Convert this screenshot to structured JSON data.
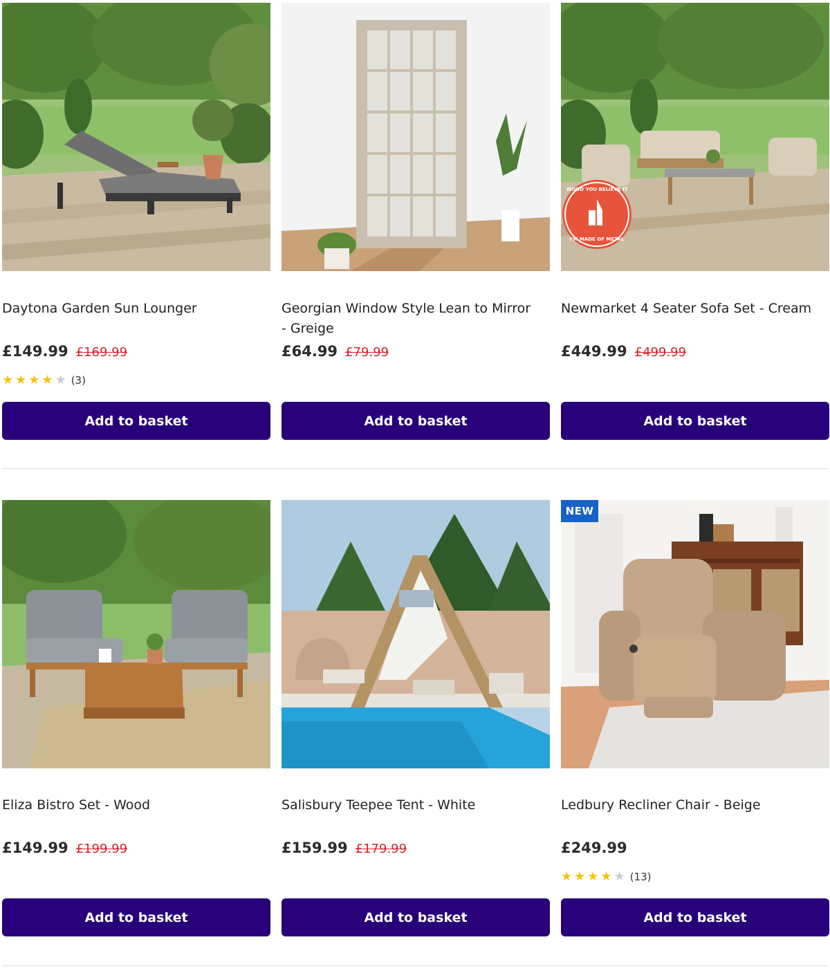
{
  "colors": {
    "button_bg": "#27007a",
    "button_text": "#ffffff",
    "was_price": "#d2232a",
    "star_on": "#f4c20d",
    "star_off": "#c9ced6",
    "new_badge": "#1862c6",
    "divider": "#cfe0e0"
  },
  "products": [
    {
      "title": "Daytona Garden Sun Lounger",
      "price": "£149.99",
      "was_price": "£169.99",
      "rating": 4,
      "rating_count": "(3)",
      "button_label": "Add to basket",
      "image": "garden-sun-lounger-photo"
    },
    {
      "title": "Georgian Window Style Lean to Mirror - Greige",
      "price": "£64.99",
      "was_price": "£79.99",
      "button_label": "Add to basket",
      "image": "window-mirror-photo"
    },
    {
      "title": "Newmarket 4 Seater Sofa Set - Cream",
      "price": "£449.99",
      "was_price": "£499.99",
      "button_label": "Add to basket",
      "image": "garden-sofa-set-photo",
      "sticker": {
        "top_text": "WOOD YOU BELIEVE IT",
        "bottom_text": "I'M MADE OF METAL"
      }
    },
    {
      "title": "Eliza Bistro Set - Wood",
      "price": "£149.99",
      "was_price": "£199.99",
      "button_label": "Add to basket",
      "image": "bistro-set-photo"
    },
    {
      "title": "Salisbury Teepee Tent - White",
      "price": "£159.99",
      "was_price": "£179.99",
      "button_label": "Add to basket",
      "image": "teepee-tent-poolside-photo"
    },
    {
      "title": "Ledbury Recliner Chair - Beige",
      "price": "£249.99",
      "rating": 4,
      "rating_count": "(13)",
      "button_label": "Add to basket",
      "image": "recliner-chair-photo",
      "badge": "NEW"
    }
  ]
}
